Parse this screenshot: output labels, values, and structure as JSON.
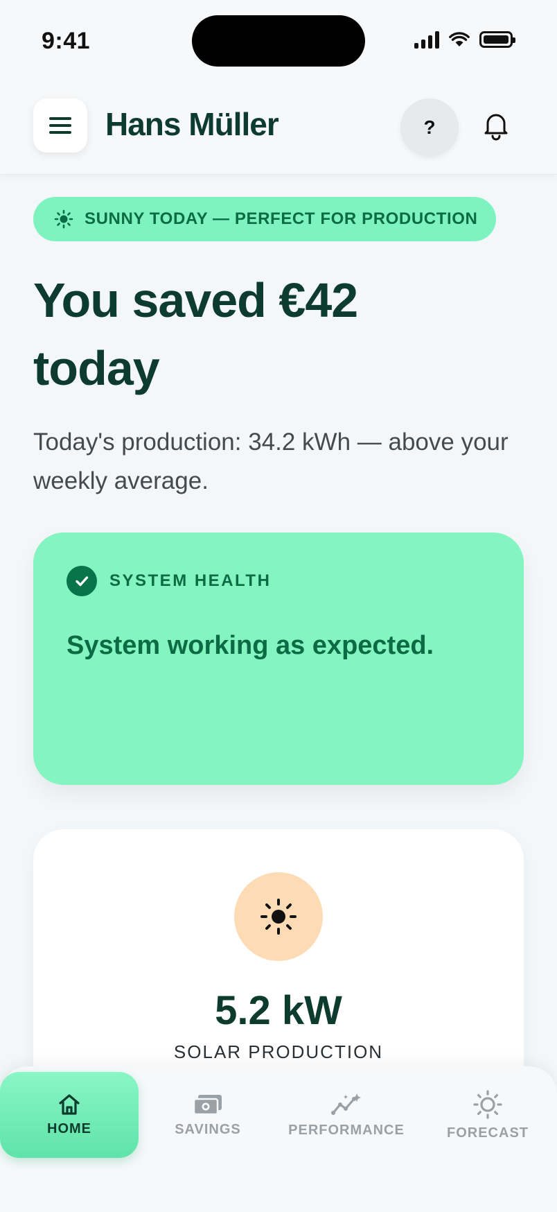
{
  "status_bar": {
    "time": "9:41"
  },
  "header": {
    "user_name": "Hans Müller",
    "help_label": "?"
  },
  "weather_badge": {
    "text": "SUNNY TODAY — PERFECT FOR PRODUCTION",
    "icon": "sun-icon"
  },
  "hero": {
    "headline": "You saved €42 today",
    "subtitle": "Today's production: 34.2 kWh — above your weekly average."
  },
  "system_health": {
    "label": "SYSTEM HEALTH",
    "message": "System working as expected.",
    "icon": "check-circle-icon"
  },
  "solar": {
    "value": "5.2 kW",
    "label": "SOLAR PRODUCTION",
    "icon": "sun-icon"
  },
  "nav": {
    "items": [
      {
        "label": "HOME",
        "icon": "home-icon",
        "active": true
      },
      {
        "label": "SAVINGS",
        "icon": "money-icon",
        "active": false
      },
      {
        "label": "PERFORMANCE",
        "icon": "chart-sparkle-icon",
        "active": false
      },
      {
        "label": "FORECAST",
        "icon": "sun-outline-icon",
        "active": false
      }
    ]
  },
  "colors": {
    "accent": "#7ef3bf",
    "accent_dark": "#0b6b44",
    "text_primary": "#0d3b2e",
    "sun_bg": "#fddcb5"
  }
}
